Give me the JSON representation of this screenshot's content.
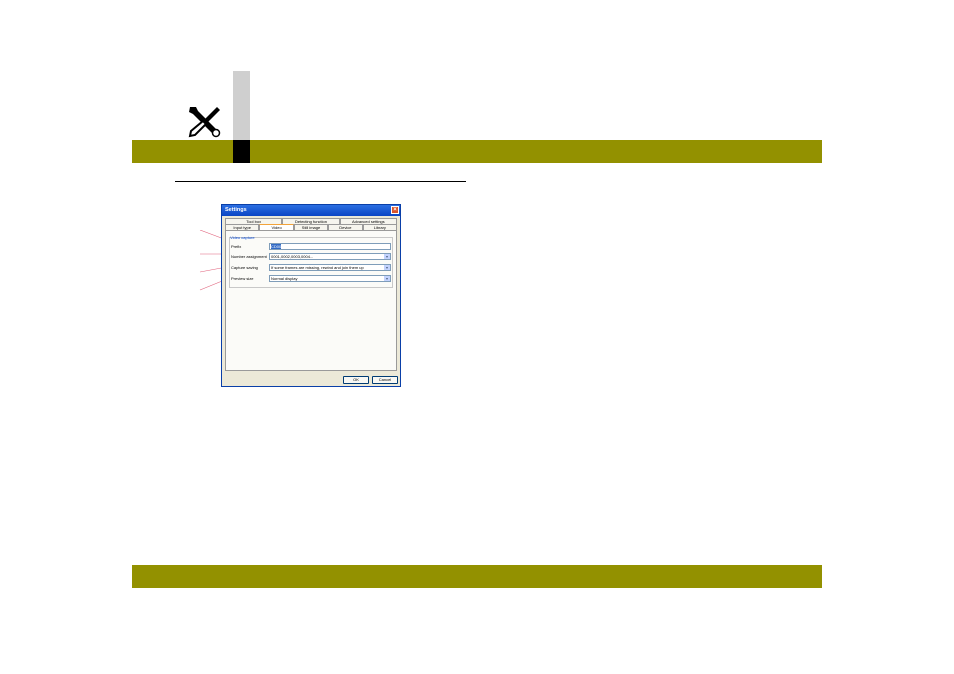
{
  "dialog": {
    "title": "Settings",
    "close_glyph": "×",
    "tabs_row1": [
      "Tool box",
      "Detecting function",
      "Advanced settings"
    ],
    "tabs_row2": [
      "Input type",
      "Video",
      "Still image",
      "Device",
      "Library"
    ],
    "active_tab": "Video",
    "group_title": "Video capture",
    "fields": [
      {
        "label": "Prefix",
        "value": "CD00"
      },
      {
        "label": "Number assignment",
        "value": "0001,0002,0003,0004..."
      },
      {
        "label": "Capture saving",
        "value": "If some frames are missing, rewind and join them up"
      },
      {
        "label": "Preview size",
        "value": "Normal display"
      }
    ],
    "ok_label": "OK",
    "cancel_label": "Cancel"
  },
  "colors": {
    "band": "#939100",
    "callout": "#e0607a"
  },
  "icons": [
    "tools-icon",
    "close-icon",
    "dropdown-arrow-icon"
  ]
}
